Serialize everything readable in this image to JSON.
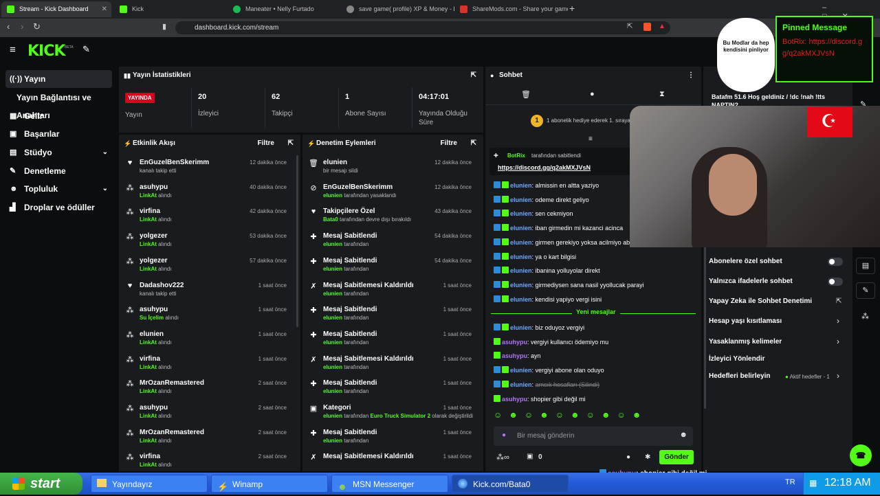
{
  "browser": {
    "tabs": [
      {
        "label": "Stream - Kick Dashboard",
        "active": true
      },
      {
        "label": "Kick"
      },
      {
        "label": "Maneater • Nelly Furtado"
      },
      {
        "label": "save game( profile) XP & Money - ET"
      },
      {
        "label": "ShareMods.com - Share your game m"
      }
    ],
    "url": "dashboard.kick.com/stream"
  },
  "app": {
    "logo": "KICK",
    "logo_beta": "BETA",
    "sidebar": [
      {
        "label": "Yayın",
        "icon": "broadcast-icon",
        "active": true
      },
      {
        "label": "Yayın Bağlantısı ve Anahtarı"
      },
      {
        "label": "Gelir",
        "icon": "money-icon"
      },
      {
        "label": "Başarılar",
        "icon": "trophy-icon"
      },
      {
        "label": "Stüdyo",
        "icon": "studio-icon",
        "expand": true
      },
      {
        "label": "Denetleme",
        "icon": "wrench-icon"
      },
      {
        "label": "Topluluk",
        "icon": "people-icon",
        "expand": true
      },
      {
        "label": "Droplar ve ödüller",
        "icon": "drops-icon"
      }
    ],
    "stats": {
      "title": "Yayın İstatistikleri",
      "live_badge": "YAYINDA",
      "live_label": "Yayın",
      "items": [
        {
          "value": "20",
          "label": "İzleyici"
        },
        {
          "value": "62",
          "label": "Takipçi"
        },
        {
          "value": "1",
          "label": "Abone Sayısı"
        },
        {
          "value": "04:17:01",
          "label": "Yayında Olduğu Süre"
        }
      ]
    },
    "activity": {
      "title": "Etkinlik Akışı",
      "filter": "Filtre",
      "rows": [
        {
          "name": "EnGuzelBenSkerimm",
          "sub": "kanalı takip etti",
          "time": "12 dakika önce",
          "icon": "heart-icon"
        },
        {
          "name": "asuhypu",
          "hl": "LinkAt",
          "sub": " alındı",
          "time": "40 dakika önce",
          "icon": "drop-icon"
        },
        {
          "name": "virfina",
          "hl": "LinkAt",
          "sub": " alındı",
          "time": "42 dakika önce",
          "icon": "drop-icon"
        },
        {
          "name": "yolgezer",
          "hl": "LinkAt",
          "sub": " alındı",
          "time": "53 dakika önce",
          "icon": "drop-icon"
        },
        {
          "name": "yolgezer",
          "hl": "LinkAt",
          "sub": " alındı",
          "time": "57 dakika önce",
          "icon": "drop-icon"
        },
        {
          "name": "Dadashov222",
          "sub": "kanalı takip etti",
          "time": "1 saat önce",
          "icon": "heart-icon"
        },
        {
          "name": "asuhypu",
          "hl": "Su İçelim",
          "sub": " alındı",
          "time": "1 saat önce",
          "icon": "drop-icon"
        },
        {
          "name": "elunien",
          "hl": "LinkAt",
          "sub": " alındı",
          "time": "1 saat önce",
          "icon": "drop-icon"
        },
        {
          "name": "virfina",
          "hl": "LinkAt",
          "sub": " alındı",
          "time": "1 saat önce",
          "icon": "drop-icon"
        },
        {
          "name": "MrOzanRemastered",
          "hl": "LinkAt",
          "sub": " alındı",
          "time": "2 saat önce",
          "icon": "drop-icon"
        },
        {
          "name": "asuhypu",
          "hl": "LinkAt",
          "sub": " alındı",
          "time": "2 saat önce",
          "icon": "drop-icon"
        },
        {
          "name": "MrOzanRemastered",
          "hl": "LinkAt",
          "sub": " alındı",
          "time": "2 saat önce",
          "icon": "drop-icon"
        },
        {
          "name": "virfina",
          "hl": "LinkAt",
          "sub": " alındı",
          "time": "2 saat önce",
          "icon": "drop-icon"
        }
      ]
    },
    "moderation": {
      "title": "Denetim Eylemleri",
      "filter": "Filtre",
      "rows": [
        {
          "name": "elunien",
          "sub": "bir mesajı sildi",
          "time": "12 dakika önce",
          "icon": "trash-icon"
        },
        {
          "name": "EnGuzelBenSkerimm",
          "hl": "elunien",
          "sub": " tarafından yasaklandı",
          "time": "12 dakika önce",
          "icon": "ban-icon"
        },
        {
          "name": "Takipçilere Özel",
          "hl": "Bata0",
          "sub": " tarafından devre dışı bırakıldı",
          "time": "43 dakika önce",
          "icon": "heart-icon"
        },
        {
          "name": "Mesaj Sabitlendi",
          "hl": "elunien",
          "sub": " tarafından",
          "time": "54 dakika önce",
          "icon": "pin-icon"
        },
        {
          "name": "Mesaj Sabitlendi",
          "hl": "elunien",
          "sub": " tarafından",
          "time": "54 dakika önce",
          "icon": "pin-icon"
        },
        {
          "name": "Mesaj Sabitlemesi Kaldırıldı",
          "hl": "elunien",
          "sub": " tarafından",
          "time": "1 saat önce",
          "icon": "unpin-icon"
        },
        {
          "name": "Mesaj Sabitlendi",
          "hl": "elunien",
          "sub": " tarafından",
          "time": "1 saat önce",
          "icon": "pin-icon"
        },
        {
          "name": "Mesaj Sabitlendi",
          "hl": "elunien",
          "sub": " tarafından",
          "time": "1 saat önce",
          "icon": "pin-icon"
        },
        {
          "name": "Mesaj Sabitlemesi Kaldırıldı",
          "hl": "elunien",
          "sub": " tarafından",
          "time": "1 saat önce",
          "icon": "unpin-icon"
        },
        {
          "name": "Mesaj Sabitlendi",
          "hl": "elunien",
          "sub": " tarafından",
          "time": "1 saat önce",
          "icon": "pin-icon"
        },
        {
          "name": "Kategori",
          "hl": "elunien",
          "sub": " tarafından ",
          "hl2": "Euro Truck Simulator 2",
          "sub2": " olarak değiştirildi",
          "time": "1 saat önce",
          "icon": "category-icon"
        },
        {
          "name": "Mesaj Sabitlendi",
          "hl": "elunien",
          "sub": " tarafından",
          "time": "1 saat önce",
          "icon": "pin-icon"
        },
        {
          "name": "Mesaj Sabitlemesi Kaldırıldı",
          "hl": "",
          "sub": "",
          "time": "1 saat önce",
          "icon": "unpin-icon"
        }
      ]
    },
    "chat": {
      "title": "Sohbet",
      "gift_banner": "1 abonelik hediye ederek 1. sırayа",
      "gift_count": "1",
      "pinned_by": "BotRix",
      "pinned_label": "tarafından sabitlendi",
      "pinned_link": "https://discord.gg/q2akMXJVsN",
      "messages": [
        {
          "user": "elunien",
          "text": "almissin en altta yaziyo",
          "color": "#6ea8ff"
        },
        {
          "user": "elunien",
          "text": "odeme direkt geliyo",
          "color": "#6ea8ff"
        },
        {
          "user": "elunien",
          "text": "sen cekmiyon",
          "color": "#6ea8ff"
        },
        {
          "user": "elunien",
          "text": "iban girmedin mi kazanci acinca",
          "color": "#6ea8ff"
        },
        {
          "user": "elunien",
          "text": "girmen gerekiyo yoksa acilmiyo abone",
          "color": "#6ea8ff"
        },
        {
          "user": "elunien",
          "text": "ya o kart bilgisi",
          "color": "#6ea8ff"
        },
        {
          "user": "elunien",
          "text": "ibanina yolluyolar direkt",
          "color": "#6ea8ff"
        },
        {
          "user": "elunien",
          "text": "girmediysen sana nasil yyollucak parayi",
          "color": "#6ea8ff"
        },
        {
          "user": "elunien",
          "text": "kendisi yapiyo vergi isini",
          "color": "#6ea8ff"
        }
      ],
      "new_label": "Yeni mesajlar",
      "messages2": [
        {
          "user": "elunien",
          "text": "biz oduyoz vergiyi",
          "color": "#6ea8ff"
        },
        {
          "user": "asuhypu",
          "text": "vergiyi kullanıcı ödemiyo mu",
          "color": "#b374f5"
        },
        {
          "user": "asuhypu",
          "text": "ayn",
          "color": "#b374f5"
        },
        {
          "user": "elunien",
          "text": "vergiyi abone olan oduyo",
          "color": "#6ea8ff"
        },
        {
          "user": "elunien",
          "text": "amcık hosafları (Silindi)",
          "color": "#6ea8ff",
          "deleted": true
        },
        {
          "user": "asuhypu",
          "text": "shopier gibi değil mi",
          "color": "#b374f5"
        }
      ],
      "input_placeholder": "Bir mesaj gönderin",
      "send": "Gönder",
      "points": "0"
    },
    "settings": {
      "welcome": "Batafm 51.6 Hoş geldiniz / !dc !nah !tts NAPTIN?",
      "items": [
        {
          "label": "Abonelere özel sohbet",
          "control": "toggle"
        },
        {
          "label": "Yalnızca ifadelerle sohbet",
          "control": "toggle"
        },
        {
          "label": "Yapay Zeka ile Sohbet Denetimi",
          "control": "external"
        },
        {
          "label": "Hesap yaşı kısıtlaması",
          "control": "chevron"
        },
        {
          "label": "Yasaklanmış kelimeler",
          "control": "chevron"
        },
        {
          "label": "İzleyici Yönlendir",
          "control": "none"
        },
        {
          "label": "Hedefleri belirleyin",
          "control": "chevron",
          "extra": "Aktif hedefler - 1"
        }
      ]
    }
  },
  "overlay": {
    "bubble": "Bu Modlar da hep kendisini pinliyor",
    "pinned_title": "Pinned Message",
    "pinned_text": "BotRix: https://discord.gg/q2akMXJVsN",
    "ticker_user": "asuhypu",
    "ticker_text": ": shopier gibi değil mi"
  },
  "taskbar": {
    "start": "start",
    "items": [
      "Yayındayız",
      "Winamp",
      "MSN Messenger",
      "Kick.com/Bata0"
    ],
    "lang": "TR",
    "time": "12:18 AM"
  },
  "colors": {
    "accent": "#53fc18",
    "live": "#d6001c",
    "user_blue": "#6ea8ff",
    "user_purple": "#b374f5"
  }
}
